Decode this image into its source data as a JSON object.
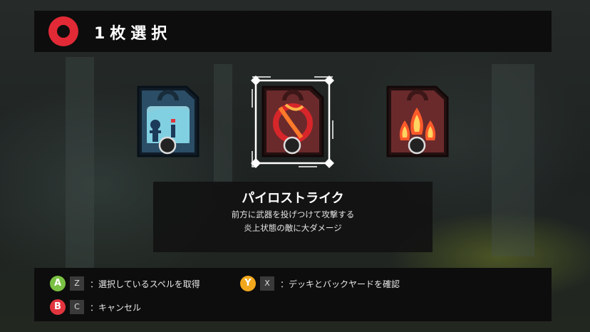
{
  "header": {
    "title": "1枚選択"
  },
  "cards": [
    {
      "name": "ice-spell",
      "selected": false
    },
    {
      "name": "fire-slash-spell",
      "selected": true
    },
    {
      "name": "fire-pillar-spell",
      "selected": false
    }
  ],
  "description": {
    "spell_name": "パイロストライク",
    "line1": "前方に武器を投げつけて攻撃する",
    "line2": "炎上状態の敵に大ダメージ"
  },
  "controls": [
    {
      "button": "A",
      "button_color": "#7ac143",
      "key": "Z",
      "text": "：選択しているスペルを取得"
    },
    {
      "button": "Y",
      "button_color": "#f2a81d",
      "key": "X",
      "text": "：デッキとバックヤードを確認"
    },
    {
      "button": "B",
      "button_color": "#e2353f",
      "key": "C",
      "text": "：キャンセル"
    }
  ],
  "colors": {
    "accent_red": "#e12a36",
    "header_bg": "#0d0d0d"
  }
}
